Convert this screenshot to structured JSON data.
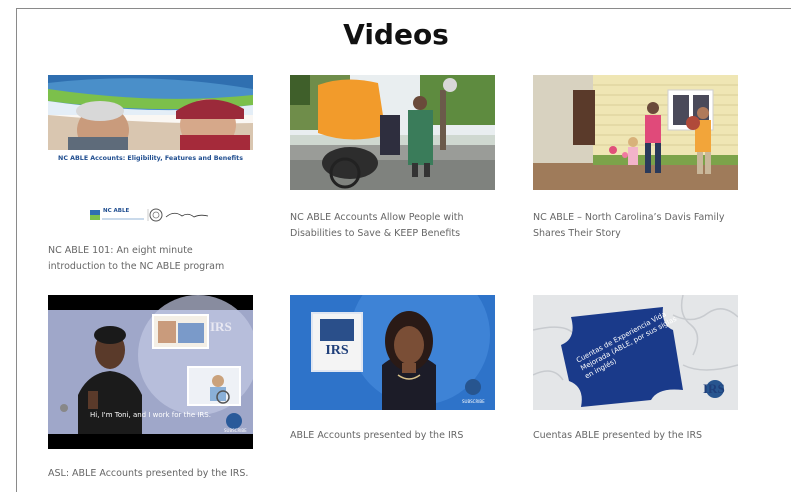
{
  "page": {
    "title": "Videos"
  },
  "videos": [
    {
      "caption": "NC ABLE 101:  An eight minute introduction to the NC ABLE program",
      "thumb_title": "NC ABLE Accounts: Eligibility, Features and Benefits",
      "logo_text": "NC ABLE"
    },
    {
      "caption": "NC ABLE Accounts Allow People with Disabilities to Save & KEEP Benefits"
    },
    {
      "caption": "NC ABLE – North Carolina’s Davis Family Shares Their Story"
    },
    {
      "caption": "ASL:  ABLE Accounts presented by the IRS.",
      "overlay_text": "Hi, I'm Toni, and I work for the IRS.",
      "logo_text": "IRS",
      "subscribe_text": "SUBSCRIBE"
    },
    {
      "caption": "ABLE Accounts presented by the IRS",
      "logo_text": "IRS",
      "subscribe_text": "SUBSCRIBE"
    },
    {
      "caption": "Cuentas ABLE presented by the IRS",
      "puzzle_text": "Cuentas de Experiencia Vida Mejorada (ABLE, por sus siglas en inglés)",
      "logo_text": "IRS"
    }
  ]
}
